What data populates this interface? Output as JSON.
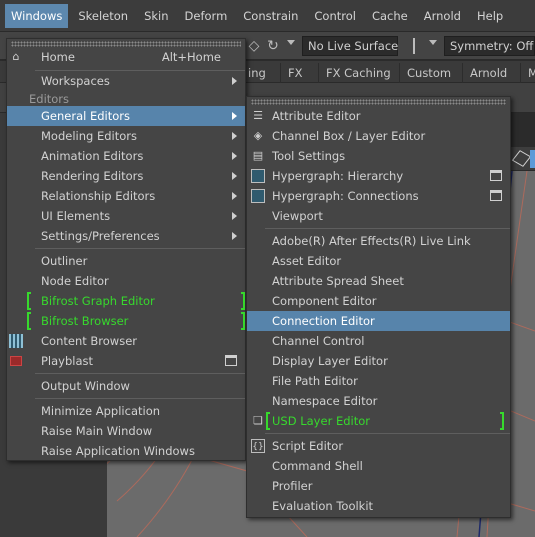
{
  "menubar": {
    "items": [
      "Windows",
      "Skeleton",
      "Skin",
      "Deform",
      "Constrain",
      "Control",
      "Cache",
      "Arnold",
      "Help"
    ]
  },
  "toolbar": {
    "live_surface": "No Live Surface",
    "symmetry": "Symmetry: Off"
  },
  "shelf": {
    "tabs": [
      "ing",
      "FX",
      "FX Caching",
      "Custom",
      "Arnold",
      "M"
    ]
  },
  "windows_menu": {
    "home": {
      "label": "Home",
      "shortcut": "Alt+Home"
    },
    "workspaces": "Workspaces",
    "editors_section": "Editors",
    "general_editors": "General Editors",
    "modeling_editors": "Modeling Editors",
    "animation_editors": "Animation Editors",
    "rendering_editors": "Rendering Editors",
    "relationship_editors": "Relationship Editors",
    "ui_elements": "UI Elements",
    "settings_preferences": "Settings/Preferences",
    "outliner": "Outliner",
    "node_editor": "Node Editor",
    "bifrost_graph_editor": "Bifrost Graph Editor",
    "bifrost_browser": "Bifrost Browser",
    "content_browser": "Content Browser",
    "playblast": "Playblast",
    "output_window": "Output Window",
    "minimize_application": "Minimize Application",
    "raise_main_window": "Raise Main Window",
    "raise_application_windows": "Raise Application Windows"
  },
  "general_editors_menu": {
    "attribute_editor": "Attribute Editor",
    "channel_box": "Channel Box / Layer Editor",
    "tool_settings": "Tool Settings",
    "hypergraph_hierarchy": "Hypergraph: Hierarchy",
    "hypergraph_connections": "Hypergraph: Connections",
    "viewport": "Viewport",
    "after_effects_live_link": "Adobe(R) After Effects(R) Live Link",
    "asset_editor": "Asset Editor",
    "attribute_spread_sheet": "Attribute Spread Sheet",
    "component_editor": "Component Editor",
    "connection_editor": "Connection Editor",
    "channel_control": "Channel Control",
    "display_layer_editor": "Display Layer Editor",
    "file_path_editor": "File Path Editor",
    "namespace_editor": "Namespace Editor",
    "usd_layer_editor": "USD Layer Editor",
    "script_editor": "Script Editor",
    "command_shell": "Command Shell",
    "profiler": "Profiler",
    "evaluation_toolkit": "Evaluation Toolkit"
  },
  "colors": {
    "highlight": "#5784ab",
    "active_menubar": "#5d88ae",
    "plugin_green": "#37d92d",
    "menu_bg": "#454545"
  }
}
